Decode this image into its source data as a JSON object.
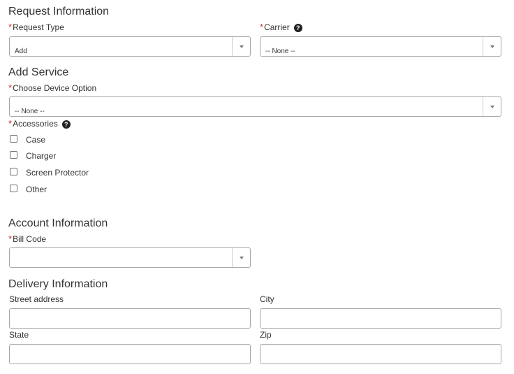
{
  "request_info": {
    "title": "Request Information",
    "request_type": {
      "label": "Request Type",
      "value": "Add"
    },
    "carrier": {
      "label": "Carrier",
      "value": "-- None --"
    }
  },
  "add_service": {
    "title": "Add Service",
    "device_option": {
      "label": "Choose Device Option",
      "value": "-- None --"
    },
    "accessories": {
      "label": "Accessories",
      "items": [
        "Case",
        "Charger",
        "Screen Protector",
        "Other"
      ]
    }
  },
  "account_info": {
    "title": "Account Information",
    "bill_code": {
      "label": "Bill Code",
      "value": ""
    }
  },
  "delivery_info": {
    "title": "Delivery Information",
    "street": {
      "label": "Street address",
      "value": ""
    },
    "city": {
      "label": "City",
      "value": ""
    },
    "state": {
      "label": "State",
      "value": ""
    },
    "zip": {
      "label": "Zip",
      "value": ""
    }
  },
  "icons": {
    "help": "question-circle-icon",
    "dropdown": "chevron-down-icon"
  },
  "colors": {
    "required": "#c0392b",
    "border": "#a7a7a7"
  }
}
